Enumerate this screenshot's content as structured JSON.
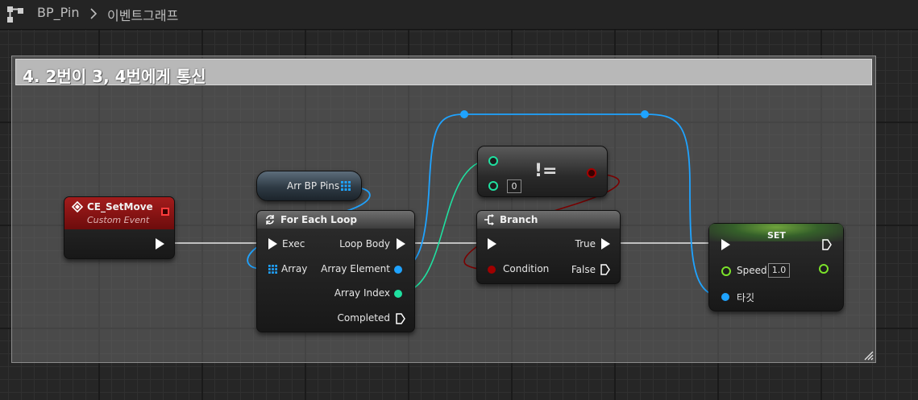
{
  "breadcrumb": {
    "blueprint": "BP_Pin",
    "graph": "이벤트그래프"
  },
  "comment": {
    "title": "4. 2번이 3, 4번에게 통신"
  },
  "nodes": {
    "custom_event": {
      "title": "CE_SetMove",
      "subtitle": "Custom Event"
    },
    "arr_var": {
      "label": "Arr BP Pins"
    },
    "for_each": {
      "title": "For Each Loop",
      "exec": "Exec",
      "array": "Array",
      "loop_body": "Loop Body",
      "array_element": "Array Element",
      "array_index": "Array Index",
      "completed": "Completed"
    },
    "not_equal": {
      "symbol": "!=",
      "value": "0"
    },
    "branch": {
      "title": "Branch",
      "condition": "Condition",
      "true": "True",
      "false": "False"
    },
    "set": {
      "title": "SET",
      "speed": "Speed",
      "speed_value": "1.0",
      "target": "타깃"
    }
  },
  "colors": {
    "exec": "#ffffff",
    "object": "#1fa3ff",
    "integer": "#1fe0a0",
    "boolean": "#8f0000",
    "float": "#9eff44",
    "event_header": "#8a1212",
    "set_header": "#3d6b2a"
  }
}
